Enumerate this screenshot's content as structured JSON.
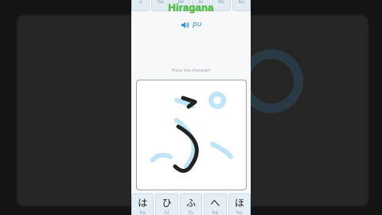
{
  "app": {
    "title": "Hiragana",
    "pronunciation": "pu",
    "instruction": "Trace the character"
  },
  "top_keys": [
    {
      "romaji": "a"
    },
    {
      "romaji": "ba"
    },
    {
      "romaji": "be"
    },
    {
      "romaji": "bi"
    },
    {
      "romaji": "bo"
    },
    {
      "romaji": "bu"
    }
  ],
  "bottom_keys": [
    {
      "kana": "は",
      "romaji": "ha"
    },
    {
      "kana": "ひ",
      "romaji": "hi"
    },
    {
      "kana": "ふ",
      "romaji": "fu"
    },
    {
      "kana": "へ",
      "romaji": "he"
    },
    {
      "kana": "ほ",
      "romaji": "ho"
    }
  ],
  "colors": {
    "title": "#47c43c",
    "accent": "#3a8fd6",
    "guide_strokes": "#bfe4f5",
    "user_strokes": "#222222"
  },
  "icons": [
    "speaker-icon"
  ]
}
